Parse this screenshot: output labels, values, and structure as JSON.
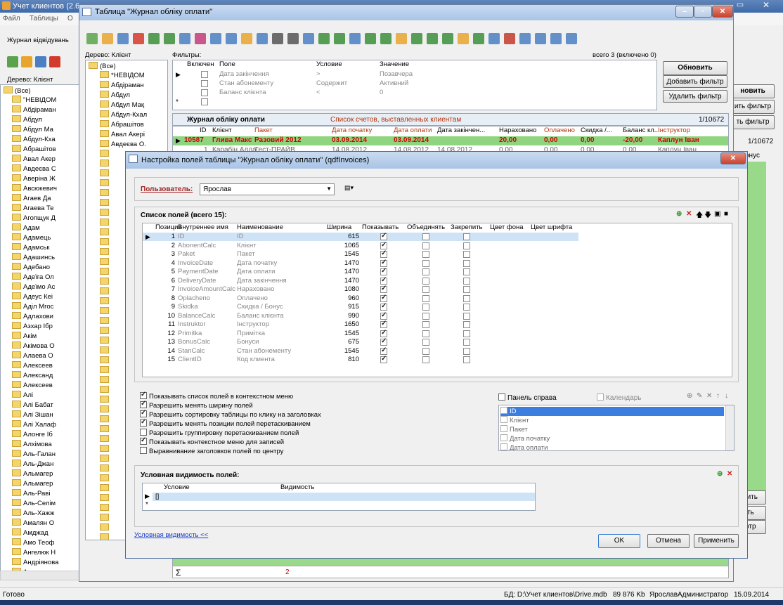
{
  "main": {
    "title": "Учет клиентов (2.6",
    "menu": [
      "Файл",
      "Таблицы",
      "О"
    ],
    "tab": "Журнал відвідувань",
    "tree_label": "Дерево: Клієнт",
    "tree_root": "(Все)",
    "clients": [
      "\"НЕВІДОМ",
      "Абдіраман",
      "Абдул",
      "Абдул Ма",
      "Абдул-Кха",
      "Абрашітов",
      "Авал Акер",
      "Авдеєва С",
      "Аверіна Ж",
      "Авсюкевич",
      "Агаев Да",
      "Агаева Те",
      "Агопщук Д",
      "Адам",
      "Адамець",
      "Адамськ",
      "Адашинсь",
      "Адебано",
      "Адеїга Ол",
      "Адеїмо Ас",
      "Адеус Кеі",
      "Аділ Мгос",
      "Адлахови",
      "Азхар Ібр",
      "Акім",
      "Акімова О",
      "Алаева О",
      "Алексеев",
      "Александ",
      "Алексеев",
      "Алі",
      "Алі Бабат",
      "Алі Зішан",
      "Алі Халаф",
      "Алонге Іб",
      "Алхімова",
      "Аль-Галан",
      "Аль-Джан",
      "Альмагер",
      "Альмагер",
      "Аль-Раві",
      "Аль-Селім",
      "Аль-Хажж",
      "Амалян О",
      "Амджад",
      "Амо Теоф",
      "Ангелюк Н",
      "Андріянова",
      "Ампронни"
    ],
    "status_left": "Готово",
    "status": [
      "БД: D:\\Учет клиентов\\Drive.mdb",
      "89 876 Kb",
      "Ярослав",
      "Администратор",
      "15.09.2014"
    ],
    "right_buttons": [
      "новить",
      "ить фильтр",
      "ть фильтр",
      "ачить",
      "ить",
      "иотр"
    ],
    "right_count": "1/10672",
    "right_col": "онус"
  },
  "journal": {
    "title": "Таблица \"Журнал обліку оплати\"",
    "tree_label": "Дерево: Клієнт",
    "tree_root": "(Все)",
    "tree_items": [
      "*НЕВІДОМ",
      "Абдіраман",
      "Абдул",
      "Абдул Мақ",
      "Абдул-Кхал",
      "Абрашітов",
      "Авал Акері",
      "Авдеєва О."
    ],
    "filters_label": "Фильтры:",
    "filters_total": "всего 3 (включено 0)",
    "filter_headers": [
      "Включен",
      "Поле",
      "Условие",
      "Значение"
    ],
    "filters": [
      {
        "field": "Дата закінчення",
        "cond": ">",
        "value": "Позавчера"
      },
      {
        "field": "Стан абонементу",
        "cond": "Содержит",
        "value": "Активний"
      },
      {
        "field": "Баланс клієнта",
        "cond": "<",
        "value": "0"
      }
    ],
    "buttons": [
      "Обновить",
      "Добавить фильтр",
      "Удалить фильтр"
    ],
    "grid_title": "Журнал обліку оплати",
    "grid_subtitle": "Список счетов, выставленных клиентам",
    "grid_count": "1/10672",
    "grid_headers": [
      "ID",
      "Клієнт",
      "Пакет",
      "Дата початку",
      "Дата оплати",
      "Дата закінчен...",
      "Нараховано",
      "Оплачено",
      "Скидка /...",
      "Баланс кл...",
      "Інструктор"
    ],
    "row1": [
      "10587",
      "Глива Макс",
      "Разовий 2012",
      "03.09.2014",
      "03.09.2014",
      "",
      "20,00",
      "0,00",
      "0,00",
      "-20,00",
      "Каплун Іван"
    ],
    "row2": [
      "1",
      "Карабін Алла",
      "Тест-ПРАЙВ",
      "14.08.2012",
      "14.08.2012",
      "14.08.2012",
      "0,00",
      "0,00",
      "0,00",
      "0,00",
      "Каплун Іван"
    ],
    "sum_label": "Σ",
    "sum_value": "2"
  },
  "dialog": {
    "title": "Настройка полей таблицы \"Журнал обліку оплати\" (qdfInvoices)",
    "user_label": "Пользователь:",
    "user_value": "Ярослав",
    "fields_title": "Список полей (всего 15):",
    "field_headers": [
      "Позиция",
      "Внутреннее имя",
      "Наименование",
      "Ширина",
      "Показывать",
      "Объединять",
      "Закрепить",
      "Цвет фона",
      "Цвет шрифта"
    ],
    "fields": [
      [
        "1",
        "ID",
        "ID",
        "615"
      ],
      [
        "2",
        "AbonentCalc",
        "Клієнт",
        "1065"
      ],
      [
        "3",
        "Paket",
        "Пакет",
        "1545"
      ],
      [
        "4",
        "InvoiceDate",
        "Дата початку",
        "1470"
      ],
      [
        "5",
        "PaymentDate",
        "Дата оплати",
        "1470"
      ],
      [
        "6",
        "DeliveryDate",
        "Дата закінчення",
        "1470"
      ],
      [
        "7",
        "InvoiceAmountCalc",
        "Нараховано",
        "1080"
      ],
      [
        "8",
        "Oplacheno",
        "Оплачено",
        "960"
      ],
      [
        "9",
        "Skidka",
        "Скидка / Бонус",
        "915"
      ],
      [
        "10",
        "BalanceCalc",
        "Баланс клієнта",
        "990"
      ],
      [
        "11",
        "Instruktor",
        "Інструктор",
        "1650"
      ],
      [
        "12",
        "Primitka",
        "Примітка",
        "1545"
      ],
      [
        "13",
        "BonusCalc",
        "Бонуси",
        "675"
      ],
      [
        "14",
        "StanCalc",
        "Стан абонементу",
        "1545"
      ],
      [
        "15",
        "ClientID",
        "Код клиента",
        "810"
      ]
    ],
    "options": [
      {
        "label": "Показывать список полей в контекстном меню",
        "on": true
      },
      {
        "label": "Разрешить менять ширину полей",
        "on": true
      },
      {
        "label": "Разрешить сортировку таблицы по клику на заголовках",
        "on": true
      },
      {
        "label": "Разрешить менять позиции полей перетаскиванием",
        "on": true
      },
      {
        "label": "Разрешить группировку перетаскиванием полей",
        "on": false
      },
      {
        "label": "Показывать контекстное меню для записей",
        "on": true
      },
      {
        "label": "Выравнивание заголовков полей по центру",
        "on": false
      }
    ],
    "panel_right": "Панель справа",
    "calendar": "Календарь",
    "panel_items": [
      "ID",
      "Клієнт",
      "Пакет",
      "Дата початку",
      "Дата оплати"
    ],
    "cond_title": "Условная видимость полей:",
    "cond_headers": [
      "Условие",
      "Видимость"
    ],
    "cond_row": "[]",
    "link": "Условная видимость <<",
    "ok": "OK",
    "cancel": "Отмена",
    "apply": "Применить"
  }
}
